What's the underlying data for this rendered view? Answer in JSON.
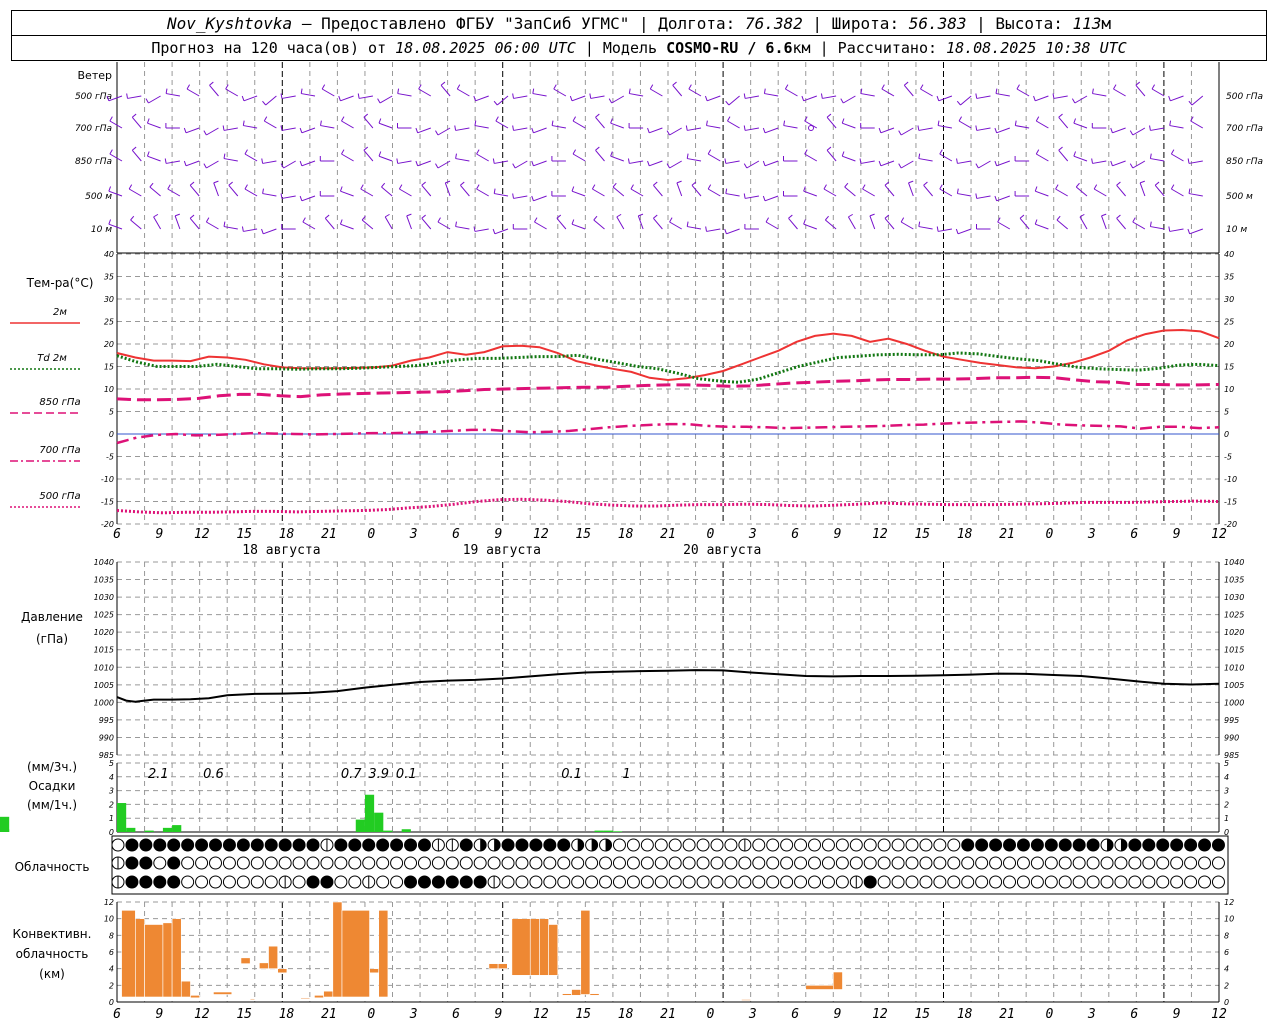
{
  "header": {
    "station": "Nov_Kyshtovka",
    "provider": "— Предоставлено ФГБУ \"ЗапСиб УГМС\" | Долгота:",
    "lon": "76.382",
    "lat_label": "| Широта:",
    "lat": "56.383",
    "alt_label": "| Высота:",
    "alt": "113",
    "alt_unit": "м",
    "forecast_prefix": "Прогноз на 120 часа(ов) от",
    "forecast_start": "18.08.2025 06:00 UTC",
    "model_prefix": "| Модель",
    "model": "COSMO-RU / 6.6",
    "model_unit": "км",
    "calc_prefix": "| Рассчитано:",
    "calc_time": "18.08.2025 10:38 UTC"
  },
  "wind_panel": {
    "title": "Ветер",
    "levels": [
      "500 гПа",
      "700 гПа",
      "850 гПа",
      "500 м",
      "10 м"
    ]
  },
  "time_axis": {
    "hour_labels": [
      "6",
      "9",
      "12",
      "15",
      "18",
      "21",
      "0",
      "3",
      "6",
      "9",
      "12",
      "15",
      "18",
      "21",
      "0",
      "3",
      "6",
      "9",
      "12",
      "15",
      "18",
      "21",
      "0",
      "3",
      "6",
      "9",
      "12"
    ],
    "dates": [
      "18 августа",
      "19 августа",
      "20 августа"
    ]
  },
  "temp_panel": {
    "title": "Тем-ра(°C)",
    "ylim": [
      -20,
      40
    ],
    "yticks": [
      40,
      35,
      30,
      25,
      20,
      15,
      10,
      5,
      0,
      -5,
      -10,
      -15,
      -20
    ],
    "legend": [
      {
        "label": "2м",
        "color": "#ee3333",
        "style": "solid"
      },
      {
        "label": "Td 2м",
        "color": "#117711",
        "style": "dotted"
      },
      {
        "label": "850 гПа",
        "color": "#dd1177",
        "style": "dashed"
      },
      {
        "label": "700 гПа",
        "color": "#dd1177",
        "style": "dashdot"
      },
      {
        "label": "500 гПа",
        "color": "#dd1177",
        "style": "dotted"
      }
    ]
  },
  "pressure_panel": {
    "title": "Давление",
    "unit": "(гПа)",
    "ylim": [
      985,
      1040
    ],
    "yticks": [
      1040,
      1035,
      1030,
      1025,
      1020,
      1015,
      1010,
      1005,
      1000,
      995,
      990,
      985
    ]
  },
  "precip_panel": {
    "unit3h": "(мм/3ч.)",
    "title": "Осадки",
    "unit1h": "(мм/1ч.)",
    "yticks": [
      5,
      4,
      3,
      2,
      1,
      0
    ],
    "totals": [
      {
        "h": 3,
        "text": "2.1"
      },
      {
        "h": 9,
        "text": "0.6"
      },
      {
        "h": 24,
        "text": "0.7"
      },
      {
        "h": 27,
        "text": "3.9"
      },
      {
        "h": 30,
        "text": "0.1"
      },
      {
        "h": 48,
        "text": "0.1"
      },
      {
        "h": 54,
        "text": "1"
      }
    ]
  },
  "cloud_panel": {
    "title": "Облачность"
  },
  "conv_panel": {
    "title1": "Конвективн.",
    "title2": "облачность",
    "unit": "(км)",
    "yticks": [
      12,
      10,
      8,
      6,
      4,
      2,
      0
    ]
  },
  "chart_data": [
    {
      "type": "line",
      "title": "Тем-ра(°C)",
      "x_hours_from_start": [
        0,
        2,
        4,
        6,
        8,
        10,
        12,
        15,
        18,
        21,
        24,
        27,
        30,
        32,
        34,
        36,
        38,
        40,
        42,
        44,
        46,
        48,
        50,
        51,
        52,
        54,
        56,
        58,
        60,
        63,
        66,
        68,
        70,
        72,
        74,
        76,
        78,
        80,
        81,
        83,
        84,
        86,
        88,
        90,
        92,
        94,
        96,
        99,
        102,
        105,
        108,
        111,
        114,
        117,
        120
      ],
      "series": [
        {
          "name": "2м",
          "color": "#ee3333",
          "values": [
            18,
            17,
            16.3,
            16.3,
            16.2,
            17.2,
            17,
            16.5,
            15.5,
            14.8,
            14.6,
            14.6,
            14.6,
            14.7,
            14.8,
            15.2,
            16.3,
            17,
            18.2,
            17.6,
            18.2,
            19.5,
            19.6,
            19.3,
            18,
            16.2,
            15.3,
            14.5,
            13.8,
            12.5,
            12,
            12.4,
            13.1,
            14,
            15.5,
            17,
            18.5,
            20.5,
            21.8,
            22.3,
            21.8,
            20.5,
            21.2,
            20,
            18.5,
            17.2,
            16.5,
            15.8,
            15.3,
            14.8,
            14.6,
            15,
            15.8,
            17,
            18.5,
            20.8,
            22.2,
            23,
            23.1,
            22.8,
            21.3
          ]
        },
        {
          "name": "Td 2м",
          "color": "#117711",
          "values": [
            17.4,
            16,
            15,
            15,
            15,
            15.5,
            15,
            14.5,
            14.5,
            14.4,
            14.5,
            14.5,
            14.6,
            14.8,
            15,
            15.2,
            15.8,
            16.5,
            16.8,
            16.8,
            17,
            17.2,
            17.2,
            17.5,
            16.6,
            15.8,
            15,
            14.5,
            13.5,
            12.3,
            11.8,
            11.5,
            12.2,
            13.6,
            15,
            16,
            17,
            17.3,
            17.6,
            17.7,
            17.6,
            17.6,
            18,
            17.8,
            17.2,
            16.7,
            16.3,
            15.5,
            14.8,
            14.5,
            14.3,
            14.2,
            14.6,
            15.3,
            15.5,
            15.2
          ]
        },
        {
          "name": "850 гПа",
          "color": "#dd1177",
          "values": [
            7.8,
            7.6,
            7.6,
            7.7,
            7.9,
            8.5,
            8.8,
            8.8,
            8.5,
            8.3,
            8.7,
            8.9,
            9,
            9.1,
            9.2,
            9.3,
            9.4,
            9.6,
            9.9,
            10,
            10.1,
            10.2,
            10.3,
            10.4,
            10.4,
            10.6,
            10.8,
            10.9,
            10.9,
            10.8,
            10.6,
            10.7,
            11,
            11.3,
            11.5,
            11.7,
            11.8,
            12,
            12.1,
            12.1,
            12.2,
            12.2,
            12.3,
            12.5,
            12.5,
            12.6,
            12.5,
            12,
            11.6,
            11.5,
            11,
            11,
            10.9,
            10.9,
            11
          ]
        },
        {
          "name": "700 гПа",
          "color": "#dd1177",
          "values": [
            -2,
            -0.8,
            -0.2,
            0,
            -0.3,
            -0.2,
            0,
            0.2,
            0.1,
            0,
            -0.1,
            0,
            0.1,
            0.2,
            0.2,
            0.3,
            0.5,
            0.7,
            0.9,
            0.9,
            0.6,
            0.4,
            0.5,
            0.7,
            1.1,
            1.5,
            1.8,
            2,
            2.2,
            2.2,
            1.8,
            1.6,
            1.6,
            1.5,
            1.3,
            1.4,
            1.5,
            1.6,
            1.7,
            1.8,
            2,
            2.1,
            2.3,
            2.5,
            2.6,
            2.7,
            2.8,
            2.5,
            2.1,
            1.9,
            1.8,
            1.7,
            1.2,
            1.6,
            1.6,
            1.3,
            1.5
          ]
        },
        {
          "name": "500 гПа",
          "color": "#dd1177",
          "values": [
            -17,
            -17.3,
            -17.5,
            -17.4,
            -17.4,
            -17.3,
            -17.2,
            -17.2,
            -17.3,
            -17.2,
            -17.1,
            -17,
            -16.8,
            -16.4,
            -16.1,
            -15.6,
            -15,
            -14.6,
            -14.5,
            -14.7,
            -15,
            -15.5,
            -15.8,
            -16,
            -16,
            -15.8,
            -15.7,
            -15.7,
            -15.6,
            -15.7,
            -15.9,
            -16,
            -15.8,
            -15.6,
            -15.3,
            -15.5,
            -15.6,
            -15.7,
            -15.7,
            -15.7,
            -15.6,
            -15.5,
            -15.4,
            -15.2,
            -15.2,
            -15.2,
            -15.1,
            -15,
            -14.9,
            -15
          ]
        }
      ],
      "ylabel": "",
      "ylim": [
        -20,
        40
      ]
    },
    {
      "type": "line",
      "title": "Давление",
      "x_hours_from_start": [
        0,
        1,
        2,
        3,
        4,
        6,
        8,
        10,
        12,
        15,
        18,
        21,
        24,
        27,
        30,
        33,
        36,
        39,
        42,
        45,
        48,
        51,
        54,
        57,
        60,
        63,
        66,
        69,
        72,
        75,
        78,
        81,
        84,
        87,
        90,
        93,
        96,
        99,
        102,
        105,
        108,
        111,
        114,
        117,
        120
      ],
      "series": [
        {
          "name": "",
          "color": "#000000",
          "values": [
            1001.5,
            1000.5,
            1000.2,
            1000.5,
            1000.8,
            1000.8,
            1000.9,
            1001.2,
            1002,
            1002.4,
            1002.5,
            1002.7,
            1003.2,
            1004.2,
            1005,
            1005.8,
            1006.2,
            1006.4,
            1006.8,
            1007.4,
            1008,
            1008.5,
            1008.7,
            1008.9,
            1009,
            1009.2,
            1009.1,
            1008.5,
            1008,
            1007.5,
            1007.4,
            1007.5,
            1007.5,
            1007.6,
            1007.7,
            1007.9,
            1008.2,
            1008.1,
            1007.8,
            1007.5,
            1006.8,
            1006,
            1005.3,
            1005.1,
            1005.3
          ]
        }
      ],
      "ylim": [
        985,
        1040
      ]
    },
    {
      "type": "bar",
      "title": "Осадки",
      "x_hours_from_start": [
        0,
        1,
        2,
        3,
        4,
        5,
        6,
        7,
        8,
        9,
        10,
        11,
        12,
        13,
        14,
        15,
        16,
        17,
        18,
        19,
        20,
        21,
        22,
        23,
        24,
        25,
        26,
        27,
        28,
        29,
        30,
        31,
        32,
        33,
        34,
        35,
        36,
        37,
        38,
        39,
        40,
        41,
        42,
        43,
        44,
        45,
        46,
        47,
        48,
        49,
        50,
        51,
        52,
        53,
        54,
        55
      ],
      "values": [
        2.1,
        0.3,
        0,
        0.1,
        0,
        0.3,
        0.5,
        0,
        0,
        0,
        0,
        0,
        0,
        0,
        0,
        0,
        0,
        0,
        0,
        0,
        0,
        0,
        0,
        0,
        0,
        0,
        0.9,
        2.7,
        1.4,
        0.1,
        0,
        0.2,
        0,
        0,
        0,
        0,
        0,
        0,
        0,
        0,
        0,
        0,
        0,
        0,
        0,
        0,
        0,
        0,
        0,
        0,
        0,
        0,
        0.1,
        0.1,
        0.05,
        0,
        1.1,
        0.2
      ],
      "ylim": [
        0,
        5
      ]
    },
    {
      "type": "bar",
      "title": "Конвективн. облачность",
      "bars_hours_km": [
        {
          "x0": 0.5,
          "x1": 2,
          "lo": 0.6,
          "hi": 11
        },
        {
          "x0": 2,
          "x1": 3,
          "lo": 0.6,
          "hi": 10
        },
        {
          "x0": 3,
          "x1": 5,
          "lo": 0.6,
          "hi": 9.3
        },
        {
          "x0": 5,
          "x1": 6,
          "lo": 0.6,
          "hi": 9.5
        },
        {
          "x0": 6,
          "x1": 7,
          "lo": 0.6,
          "hi": 10
        },
        {
          "x0": 7,
          "x1": 8,
          "lo": 0.6,
          "hi": 2.5
        },
        {
          "x0": 8,
          "x1": 9,
          "lo": 0.5,
          "hi": 0.8
        },
        {
          "x0": 10.5,
          "x1": 12.5,
          "lo": 0.9,
          "hi": 1.2
        },
        {
          "x0": 13.5,
          "x1": 14.5,
          "lo": 4.6,
          "hi": 5.3
        },
        {
          "x0": 14.5,
          "x1": 15,
          "lo": 0.3,
          "hi": 0.4
        },
        {
          "x0": 15.5,
          "x1": 16.5,
          "lo": 4,
          "hi": 4.7
        },
        {
          "x0": 16.5,
          "x1": 17.5,
          "lo": 4,
          "hi": 6.7
        },
        {
          "x0": 17.5,
          "x1": 18.5,
          "lo": 3.5,
          "hi": 4
        },
        {
          "x0": 20,
          "x1": 21,
          "lo": 0.4,
          "hi": 0.5
        },
        {
          "x0": 21.5,
          "x1": 22.5,
          "lo": 0.5,
          "hi": 0.8
        },
        {
          "x0": 22.5,
          "x1": 23.5,
          "lo": 0.6,
          "hi": 1.3
        },
        {
          "x0": 23.5,
          "x1": 24.5,
          "lo": 0.6,
          "hi": 12
        },
        {
          "x0": 24.5,
          "x1": 27.5,
          "lo": 0.6,
          "hi": 11
        },
        {
          "x0": 27.5,
          "x1": 28.5,
          "lo": 3.5,
          "hi": 4
        },
        {
          "x0": 28.5,
          "x1": 29.5,
          "lo": 0.6,
          "hi": 11
        },
        {
          "x0": 40.5,
          "x1": 41.5,
          "lo": 4,
          "hi": 4.6
        },
        {
          "x0": 41.5,
          "x1": 42.5,
          "lo": 4,
          "hi": 4.6
        },
        {
          "x0": 43,
          "x1": 45,
          "lo": 3.2,
          "hi": 10
        },
        {
          "x0": 45,
          "x1": 46,
          "lo": 3.2,
          "hi": 10
        },
        {
          "x0": 46,
          "x1": 47,
          "lo": 3.2,
          "hi": 10
        },
        {
          "x0": 47,
          "x1": 48,
          "lo": 3.2,
          "hi": 9.3
        },
        {
          "x0": 48.5,
          "x1": 49.5,
          "lo": 0.8,
          "hi": 1
        },
        {
          "x0": 49.5,
          "x1": 50.5,
          "lo": 0.8,
          "hi": 1.5
        },
        {
          "x0": 50.5,
          "x1": 51.5,
          "lo": 0.9,
          "hi": 11
        },
        {
          "x0": 51.5,
          "x1": 52.5,
          "lo": 0.8,
          "hi": 1
        },
        {
          "x0": 68,
          "x1": 69,
          "lo": 0.2,
          "hi": 0.3
        },
        {
          "x0": 75,
          "x1": 78,
          "lo": 1.5,
          "hi": 2
        },
        {
          "x0": 78,
          "x1": 79,
          "lo": 1.5,
          "hi": 3.6
        }
      ],
      "ylim": [
        0,
        12
      ]
    }
  ],
  "colors": {
    "wind": "#7711cc",
    "grid": "#999999",
    "precip": "#22cc22",
    "conv": "#ee8833",
    "temp_2m": "#ee3333",
    "td": "#117711",
    "upper": "#dd1177"
  }
}
